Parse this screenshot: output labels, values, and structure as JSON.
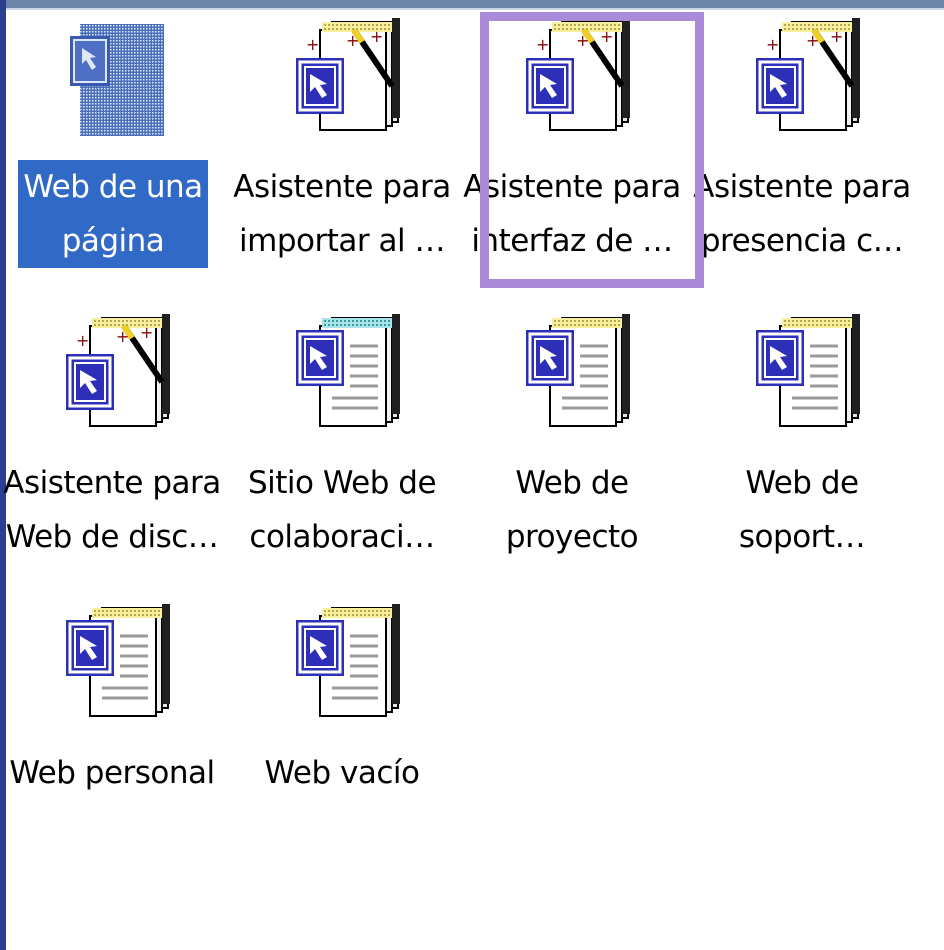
{
  "items": [
    {
      "line1": "Web de una",
      "line2": "página",
      "icon": "single-page-web-icon",
      "selected": true
    },
    {
      "line1": "Asistente para",
      "line2": "importar al …",
      "icon": "wizard-icon"
    },
    {
      "line1": "Asistente para",
      "line2": "interfaz de …",
      "icon": "wizard-icon",
      "highlighted": true
    },
    {
      "line1": "Asistente para",
      "line2": "presencia c…",
      "icon": "wizard-icon"
    },
    {
      "line1": "Asistente para",
      "line2": "Web de disc…",
      "icon": "wizard-icon"
    },
    {
      "line1": "Sitio Web de",
      "line2": "colaboraci…",
      "icon": "template-icon"
    },
    {
      "line1": "Web de",
      "line2": "proyecto",
      "icon": "template-icon"
    },
    {
      "line1": "Web de",
      "line2": "soport…",
      "icon": "template-icon"
    },
    {
      "line1": "Web personal",
      "line2": "",
      "icon": "template-icon"
    },
    {
      "line1": "Web vacío",
      "line2": "",
      "icon": "template-icon"
    }
  ],
  "colors": {
    "selection": "#3169c6",
    "highlight_frame": "#a98bd8",
    "icon_blue": "#2d2fb8"
  }
}
